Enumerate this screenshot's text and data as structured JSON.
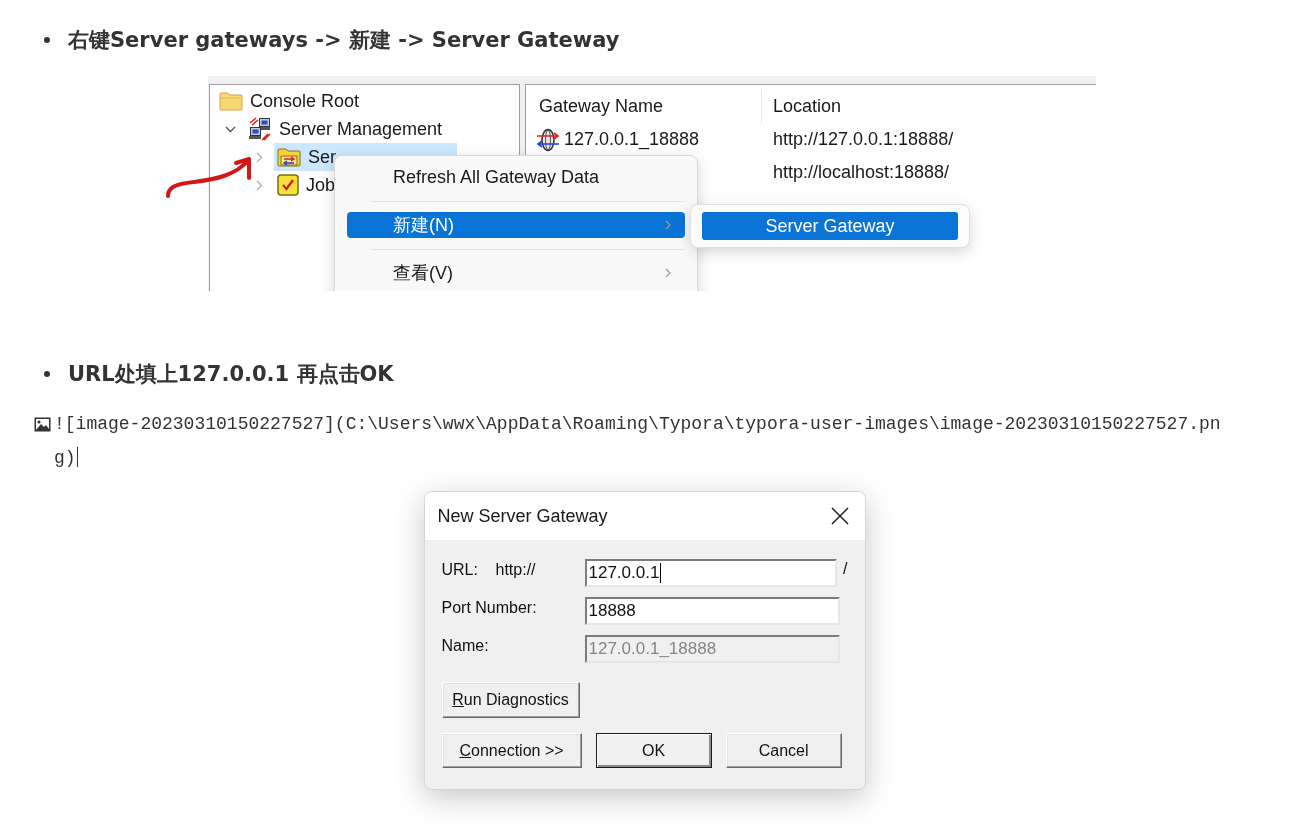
{
  "step_1": {
    "heading": "右键Server gateways -> 新建 -> Server Gateway"
  },
  "console_screenshot": {
    "tree": [
      {
        "label": "Console Root",
        "kind": "folder",
        "selected": false,
        "children": [
          {
            "label": "Server Management",
            "kind": "network",
            "expanded": true,
            "selected": false,
            "children": [
              {
                "label": "Ser",
                "kind": "gateway",
                "expanded": false,
                "selected": true
              },
              {
                "label": "Job",
                "kind": "task",
                "expanded": false,
                "selected": false
              }
            ]
          }
        ]
      }
    ],
    "list": {
      "columns": [
        "Gateway Name",
        "Location"
      ],
      "rows": [
        {
          "name": "127.0.0.1_18888",
          "location": "http://127.0.0.1:18888/"
        },
        {
          "location": "http://localhost:18888/"
        }
      ]
    },
    "context_menu": {
      "items": [
        {
          "label": "Refresh All Gateway Data",
          "submenu": false,
          "selected": false
        },
        {
          "label": "新建(N)",
          "submenu": true,
          "selected": true
        },
        {
          "label": "查看(V)",
          "submenu": true,
          "selected": false
        }
      ]
    },
    "submenu": {
      "items": [
        {
          "label": "Server Gateway",
          "selected": true
        }
      ]
    }
  },
  "step_2": {
    "heading": "URL处填上127.0.0.1 再点击OK"
  },
  "image_source_line": {
    "text": "![image-20230310150227527](C:\\Users\\wwx\\AppData\\Roaming\\Typora\\typora-user-images\\image-20230310150227527.png)",
    "caret": true
  },
  "dialog_screenshot": {
    "title": "New Server Gateway",
    "fields": [
      {
        "label": "URL:",
        "prefix": "http://",
        "value": "127.0.0.1",
        "suffix": "/",
        "focused": true,
        "disabled": false
      },
      {
        "label": "Port Number:",
        "value": "18888",
        "focused": false,
        "disabled": false
      },
      {
        "label": "Name:",
        "value": "127.0.0.1_18888",
        "focused": false,
        "disabled": true
      }
    ],
    "diagnostics_button": {
      "label": "Run Diagnostics",
      "mnemonic": true
    },
    "buttons": [
      {
        "label": "Connection >>",
        "mnemonic": true,
        "default": false
      },
      {
        "label": "OK",
        "mnemonic": false,
        "default": true
      },
      {
        "label": "Cancel",
        "mnemonic": false,
        "default": false
      }
    ]
  }
}
